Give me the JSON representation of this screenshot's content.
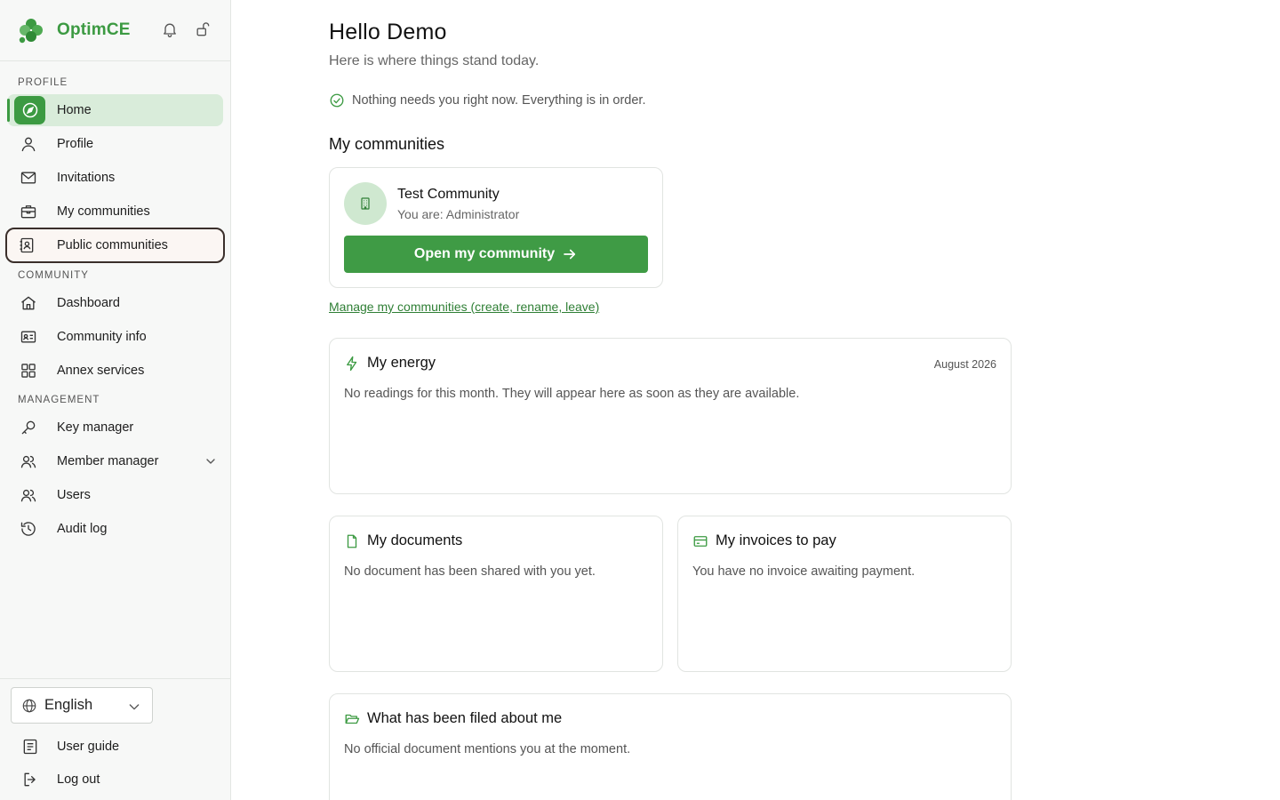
{
  "brand": {
    "name": "OptimCE"
  },
  "colors": {
    "accent": "#3c9a42",
    "active_bg": "#d9ecda",
    "avatar_bg": "#cfe8d0"
  },
  "sidebar": {
    "sections": [
      {
        "label": "PROFILE"
      },
      {
        "label": "COMMUNITY"
      },
      {
        "label": "MANAGEMENT"
      }
    ],
    "items": [
      {
        "label": "Home",
        "icon": "compass-icon",
        "active": true
      },
      {
        "label": "Profile",
        "icon": "user-icon"
      },
      {
        "label": "Invitations",
        "icon": "mail-icon"
      },
      {
        "label": "My communities",
        "icon": "briefcase-icon"
      },
      {
        "label": "Public communities",
        "icon": "contact-book-icon",
        "focused": true
      },
      {
        "label": "Dashboard",
        "icon": "house-icon"
      },
      {
        "label": "Community info",
        "icon": "id-card-icon"
      },
      {
        "label": "Annex services",
        "icon": "grid-icon"
      },
      {
        "label": "Key manager",
        "icon": "key-icon"
      },
      {
        "label": "Member manager",
        "icon": "members-icon",
        "expandable": true
      },
      {
        "label": "Users",
        "icon": "users-icon"
      },
      {
        "label": "Audit log",
        "icon": "history-icon"
      }
    ],
    "language": {
      "selected": "English"
    },
    "bottom": [
      {
        "label": "User guide",
        "icon": "book-icon"
      },
      {
        "label": "Log out",
        "icon": "logout-icon"
      }
    ]
  },
  "main": {
    "greeting": "Hello Demo",
    "subtitle": "Here is where things stand today.",
    "status": "Nothing needs you right now. Everything is in order.",
    "communities_heading": "My communities",
    "community": {
      "name": "Test Community",
      "role": "You are: Administrator",
      "open_label": "Open my community"
    },
    "manage_link": "Manage my communities (create, rename, leave)",
    "energy": {
      "title": "My energy",
      "date": "August 2026",
      "body": "No readings for this month. They will appear here as soon as they are available."
    },
    "documents": {
      "title": "My documents",
      "body": "No document has been shared with you yet."
    },
    "invoices": {
      "title": "My invoices to pay",
      "body": "You have no invoice awaiting payment."
    },
    "filed": {
      "title": "What has been filed about me",
      "body": "No official document mentions you at the moment."
    }
  }
}
